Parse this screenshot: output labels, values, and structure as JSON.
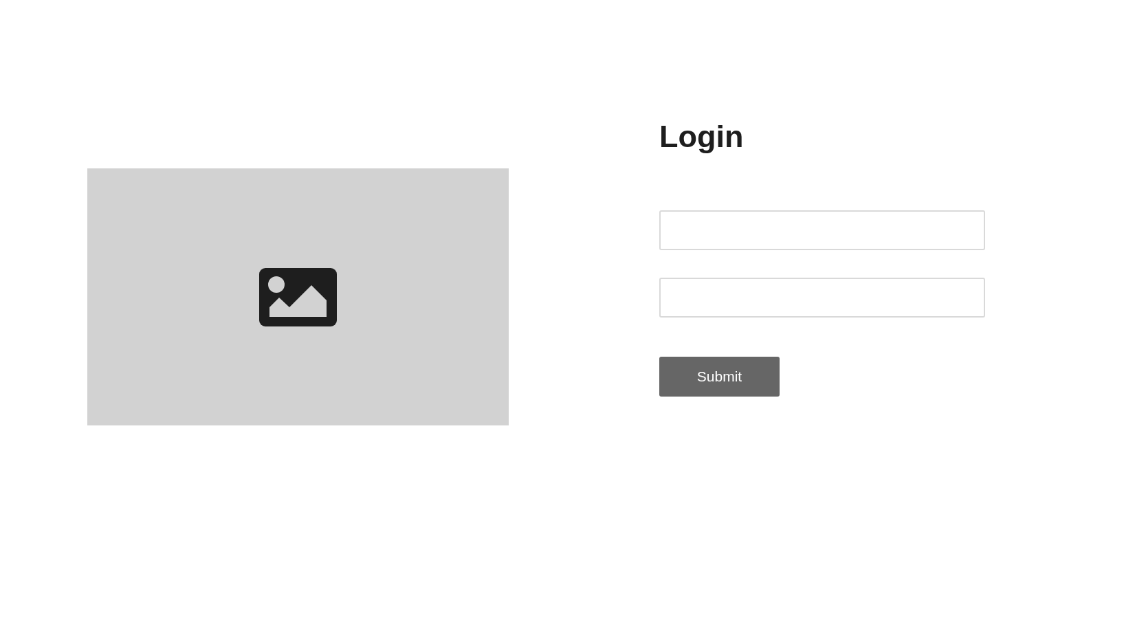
{
  "image": {
    "kind": "placeholder"
  },
  "form": {
    "title": "Login",
    "fields": [
      {
        "kind": "text"
      },
      {
        "kind": "text"
      }
    ],
    "submit": "Submit"
  }
}
